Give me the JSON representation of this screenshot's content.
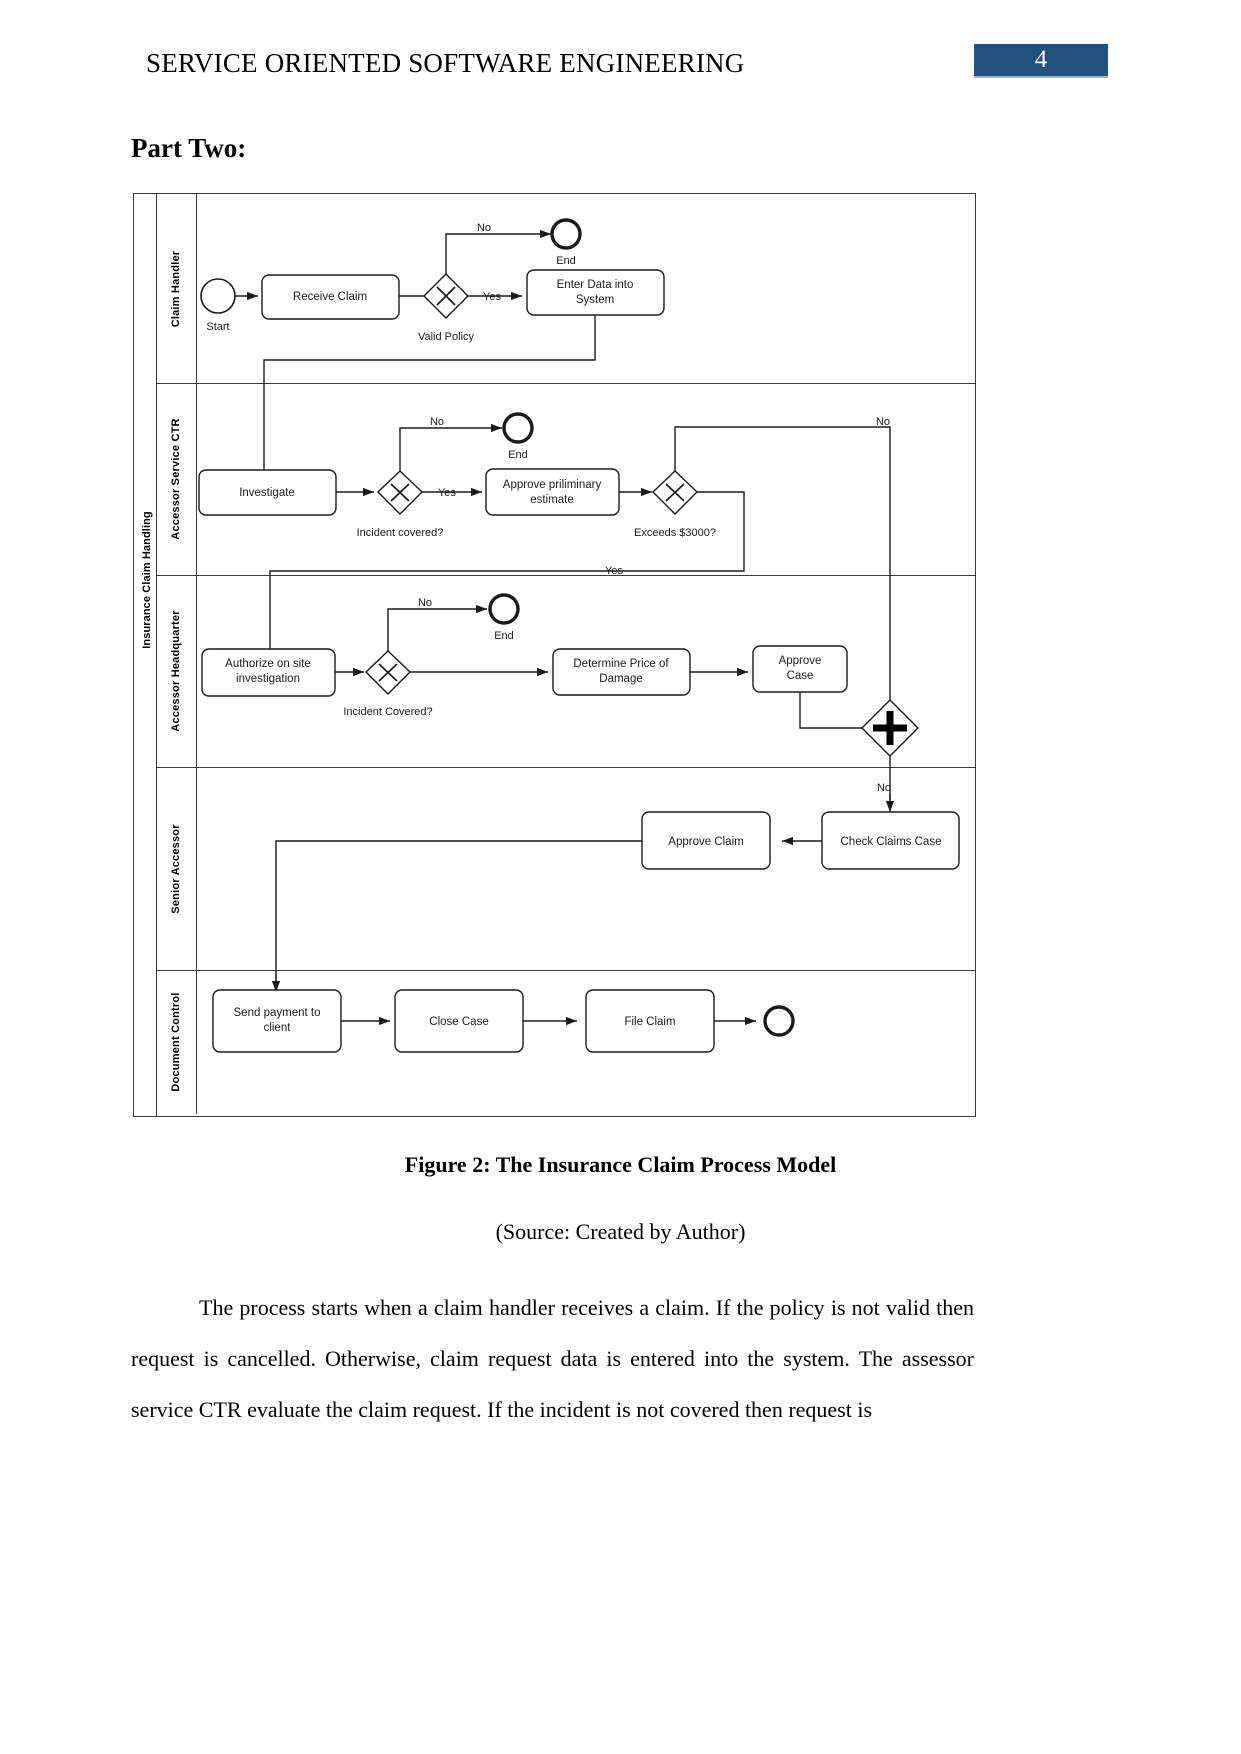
{
  "header": {
    "title": "SERVICE ORIENTED SOFTWARE ENGINEERING",
    "page_number": "4",
    "badge_color": "#21517d"
  },
  "section": {
    "heading": "Part Two:"
  },
  "figure": {
    "pool_label": "Insurance Claim Handling",
    "caption": "Figure 2: The Insurance Claim Process Model",
    "source": "(Source: Created by Author)",
    "lanes": [
      {
        "name": "Claim Handler"
      },
      {
        "name": "Accessor Service CTR"
      },
      {
        "name": "Accessor Headquarter"
      },
      {
        "name": "Senior Accessor"
      },
      {
        "name": "Document Control"
      }
    ],
    "nodes": {
      "start_label": "Start",
      "receive_claim": "Receive Claim",
      "valid_policy": "Valid Policy",
      "enter_data_l1": "Enter Data into",
      "enter_data_l2": "System",
      "end_1": "End",
      "investigate": "Investigate",
      "incident_covered_2": "Incident covered?",
      "approve_prelim_l1": "Approve priliminary",
      "approve_prelim_l2": "estimate",
      "exceeds_3000": "Exceeds $3000?",
      "end_2": "End",
      "authorize_l1": "Authorize on site",
      "authorize_l2": "investigation",
      "incident_covered_3": "Incident Covered?",
      "determine_price_l1": "Determine Price of",
      "determine_price_l2": "Damage",
      "approve_case_l1": "Approve",
      "approve_case_l2": "Case",
      "end_3": "End",
      "check_claims_case": "Check Claims Case",
      "approve_claim": "Approve Claim",
      "send_payment_l1": "Send payment to",
      "send_payment_l2": "client",
      "close_case": "Close Case",
      "file_claim": "File Claim"
    },
    "flow_labels": {
      "no_1": "No",
      "yes_1": "Yes",
      "no_2": "No",
      "yes_2": "Yes",
      "no_exceeds": "No",
      "yes_exceeds": "Yes",
      "no_3": "No",
      "no_parallel": "No"
    }
  },
  "body": {
    "paragraph": "The process starts when a claim handler receives a claim. If the policy is not valid then request is cancelled. Otherwise, claim request data is entered into the system. The assessor service CTR evaluate the claim request. If the incident is not covered then request is"
  }
}
